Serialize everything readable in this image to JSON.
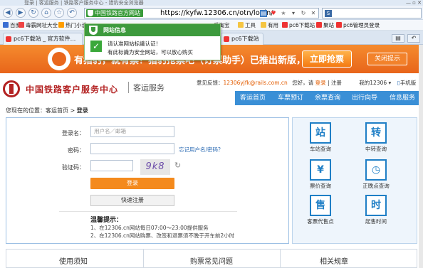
{
  "browser": {
    "title": "登录 | 客运服务 | 铁路客户服务中心 - 猎豹安全浏览器",
    "url": "https://kyfw.12306.cn/otn/login/",
    "security_badge": "中国铁路官方网站",
    "bookmarks": [
      "百度",
      "毒霸网址大全",
      "热门小说",
      "爱淘宝",
      "工具",
      "有用",
      "pc6下载站",
      "聚站",
      "pc6管理员登录"
    ],
    "tabs": [
      {
        "label": "pc6下载站 _ 官方软件..."
      },
      {
        "label": "pc6下载站"
      }
    ],
    "colors": {
      "secure_green": "#3d9a3d",
      "chrome_blue": "#dbe5f1"
    }
  },
  "popup": {
    "header": "网站信息",
    "line1": "请认准网站标識认证！",
    "line2": "有此标識为安全网站，可以放心购买"
  },
  "banner": {
    "text": "有猎豹，就有票！猎豹抢票吧（订票助手）已推出新版，点此",
    "buy_button": "立即抢票",
    "close_button": "关闭提示",
    "color": "#f58b2e"
  },
  "site": {
    "title": "中国铁路客户服务中心",
    "subtitle": "客运服务",
    "feedback_label": "意见反馈：",
    "feedback_email": "12306yjfk@rails.com.cn",
    "greeting": "您好，请",
    "login_link": "登录",
    "register_link": "注册",
    "my_account": "我的12306",
    "mobile": "手机版",
    "nav": [
      "客运首页",
      "车票预订",
      "余票查询",
      "出行向导",
      "信息服务"
    ]
  },
  "breadcrumb": {
    "prefix": "您现在的位置：",
    "home": "客运首页",
    "sep": ">",
    "current": "登录"
  },
  "login": {
    "username_label": "登录名：",
    "username_placeholder": "用户名／邮箱",
    "password_label": "密码：",
    "forgot": "忘记用户名/密码？",
    "captcha_label": "验证码：",
    "captcha_text": "9k8",
    "login_button": "登录",
    "register_button": "快速注册",
    "tip_title": "温馨提示：",
    "tips": [
      "1、在12306.cn网站每日07:00～23:00提供服务",
      "2、在12306.cn网站购票、改签和退票须不晚于开车前2小时"
    ]
  },
  "quick": [
    {
      "label": "车站查询",
      "icon": "station-icon",
      "glyph": "站"
    },
    {
      "label": "中转查询",
      "icon": "transfer-icon",
      "glyph": "转"
    },
    {
      "label": "票价查询",
      "icon": "price-icon",
      "glyph": "¥"
    },
    {
      "label": "正晚点查询",
      "icon": "clock-icon",
      "glyph": "◷"
    },
    {
      "label": "客票代售点",
      "icon": "agency-icon",
      "glyph": "售"
    },
    {
      "label": "起售时间",
      "icon": "calendar-icon",
      "glyph": "时"
    }
  ],
  "bottom_tabs": [
    "使用须知",
    "购票常见问题",
    "相关规章"
  ]
}
